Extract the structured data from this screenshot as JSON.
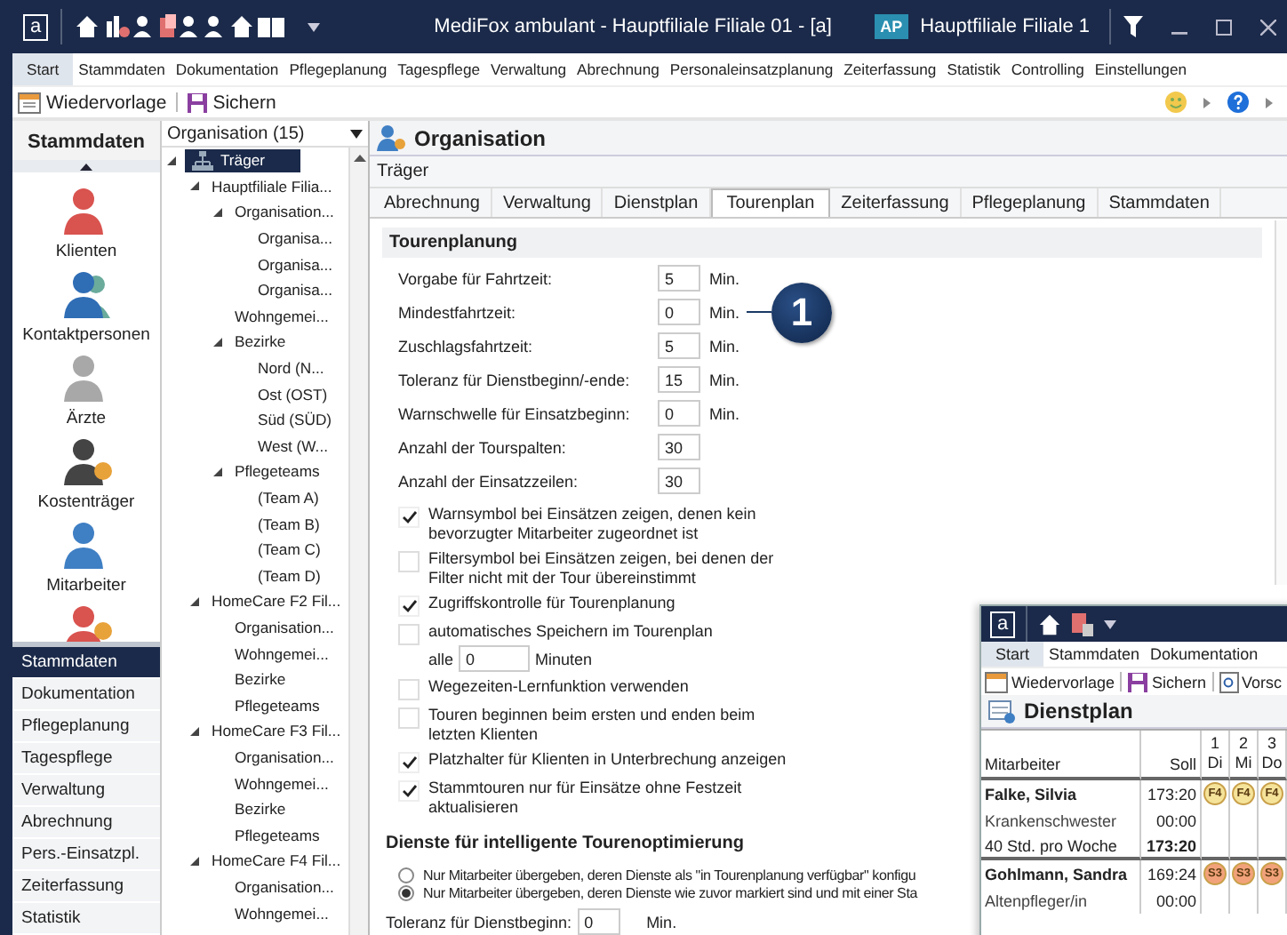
{
  "window": {
    "title": "MediFox ambulant  -  Hauptfiliale Filiale 01 - [a]",
    "app_badge": "a",
    "user_badge": "AP",
    "branch": "Hauptfiliale Filiale 1"
  },
  "menu": [
    {
      "label": "Start",
      "selected": true
    },
    {
      "label": "Stammdaten",
      "selected": false
    },
    {
      "label": "Dokumentation",
      "selected": false
    },
    {
      "label": "Pflegeplanung",
      "selected": false
    },
    {
      "label": "Tagespflege",
      "selected": false
    },
    {
      "label": "Verwaltung",
      "selected": false
    },
    {
      "label": "Abrechnung",
      "selected": false
    },
    {
      "label": "Personaleinsatzplanung",
      "selected": false
    },
    {
      "label": "Zeiterfassung",
      "selected": false
    },
    {
      "label": "Statistik",
      "selected": false
    },
    {
      "label": "Controlling",
      "selected": false
    },
    {
      "label": "Einstellungen",
      "selected": false
    }
  ],
  "toolbar": [
    "Wiedervorlage",
    "Sichern"
  ],
  "nav": {
    "title": "Stammdaten",
    "icons": [
      {
        "label": "Klienten",
        "color": "#d9534f",
        "kind": "person"
      },
      {
        "label": "Kontaktpersonen",
        "color": "#2f6db5",
        "kind": "group"
      },
      {
        "label": "Ärzte",
        "color": "#a8a8a8",
        "kind": "person"
      },
      {
        "label": "Kostenträger",
        "color": "#444444",
        "kind": "payer"
      },
      {
        "label": "Mitarbeiter",
        "color": "#3f7fc4",
        "kind": "person"
      },
      {
        "color": "#d9534f",
        "kind": "question"
      }
    ],
    "items": [
      {
        "label": "Stammdaten",
        "selected": true
      },
      {
        "label": "Dokumentation",
        "selected": false
      },
      {
        "label": "Pflegeplanung",
        "selected": false
      },
      {
        "label": "Tagespflege",
        "selected": false
      },
      {
        "label": "Verwaltung",
        "selected": false
      },
      {
        "label": "Abrechnung",
        "selected": false
      },
      {
        "label": "Pers.-Einsatzpl.",
        "selected": false
      },
      {
        "label": "Zeiterfassung",
        "selected": false
      },
      {
        "label": "Statistik",
        "selected": false
      }
    ]
  },
  "tree": {
    "header": "Organisation (15)",
    "items": [
      {
        "label": "Träger",
        "selected": true,
        "children": [
          {
            "label": "Hauptfiliale Filia...",
            "selected": false,
            "children": [
              {
                "label": "Organisation...",
                "selected": false,
                "children": [
                  {
                    "label": "Organisa...",
                    "selected": false
                  },
                  {
                    "label": "Organisa...",
                    "selected": false
                  },
                  {
                    "label": "Organisa...",
                    "selected": false
                  }
                ]
              },
              {
                "label": "Wohngemei...",
                "selected": false
              },
              {
                "label": "Bezirke",
                "selected": false,
                "children": [
                  {
                    "label": "Nord (N...",
                    "selected": false
                  },
                  {
                    "label": "Ost (OST)",
                    "selected": false
                  },
                  {
                    "label": "Süd (SÜD)",
                    "selected": false
                  },
                  {
                    "label": "West (W...",
                    "selected": false
                  }
                ]
              },
              {
                "label": "Pflegeteams",
                "selected": false,
                "children": [
                  {
                    "label": "(Team A)",
                    "selected": false
                  },
                  {
                    "label": "(Team B)",
                    "selected": false
                  },
                  {
                    "label": "(Team C)",
                    "selected": false
                  },
                  {
                    "label": "(Team D)",
                    "selected": false
                  }
                ]
              }
            ]
          },
          {
            "label": "HomeCare F2 Fil...",
            "selected": false,
            "children": [
              {
                "label": "Organisation...",
                "selected": false
              },
              {
                "label": "Wohngemei...",
                "selected": false
              },
              {
                "label": "Bezirke",
                "selected": false
              },
              {
                "label": "Pflegeteams",
                "selected": false
              }
            ]
          },
          {
            "label": "HomeCare F3 Fil...",
            "selected": false,
            "children": [
              {
                "label": "Organisation...",
                "selected": false
              },
              {
                "label": "Wohngemei...",
                "selected": false
              },
              {
                "label": "Bezirke",
                "selected": false
              },
              {
                "label": "Pflegeteams",
                "selected": false
              }
            ]
          },
          {
            "label": "HomeCare F4 Fil...",
            "selected": false,
            "children": [
              {
                "label": "Organisation...",
                "selected": false
              },
              {
                "label": "Wohngemei...",
                "selected": false
              }
            ]
          }
        ]
      }
    ]
  },
  "panel": {
    "title": "Organisation",
    "breadcrumb": "Träger",
    "tabs": [
      {
        "label": "Abrechnung",
        "selected": false
      },
      {
        "label": "Verwaltung",
        "selected": false
      },
      {
        "label": "Dienstplan",
        "selected": false
      },
      {
        "label": "Tourenplan",
        "selected": true
      },
      {
        "label": "Zeiterfassung",
        "selected": false
      },
      {
        "label": "Pflegeplanung",
        "selected": false
      },
      {
        "label": "Stammdaten",
        "selected": false
      }
    ],
    "section1": "Tourenplanung",
    "fields": [
      {
        "label": "Vorgabe für Fahrtzeit:",
        "value": "5",
        "unit": "Min."
      },
      {
        "label": "Mindestfahrtzeit:",
        "value": "0",
        "unit": "Min."
      },
      {
        "label": "Zuschlagsfahrtzeit:",
        "value": "5",
        "unit": "Min."
      },
      {
        "label": "Toleranz für Dienstbeginn/-ende:",
        "value": "15",
        "unit": "Min."
      },
      {
        "label": "Warnschwelle für Einsatzbeginn:",
        "value": "0",
        "unit": "Min."
      },
      {
        "label": "Anzahl der Tourspalten:",
        "value": "30"
      },
      {
        "label": "Anzahl der Einsatzzeilen:",
        "value": "30"
      }
    ],
    "callout": "1",
    "options": [
      {
        "kind": "checkbox",
        "label": "Warnsymbol bei Einsätzen zeigen, denen kein\nbevorzugter Mitarbeiter zugeordnet ist",
        "checked": true
      },
      {
        "kind": "checkbox",
        "label": "Filtersymbol bei Einsätzen zeigen, bei denen der\nFilter nicht mit der Tour übereinstimmt",
        "checked": false
      },
      {
        "kind": "checkbox",
        "label": "Zugriffskontrolle für Tourenplanung",
        "checked": true
      },
      {
        "kind": "interval",
        "label": "automatisches Speichern im Tourenplan",
        "checked": false,
        "prefix": "alle",
        "value": "0",
        "suffix": "Minuten"
      },
      {
        "kind": "checkbox",
        "label": "Wegezeiten-Lernfunktion verwenden",
        "checked": false
      },
      {
        "kind": "checkbox",
        "label": "Touren beginnen beim ersten und enden beim\nletzten Klienten",
        "checked": false
      },
      {
        "kind": "checkbox",
        "label": "Platzhalter für Klienten in Unterbrechung anzeigen",
        "checked": true
      },
      {
        "kind": "checkbox",
        "label": "Stammtouren nur für Einsätze ohne Festzeit\naktualisieren",
        "checked": true
      }
    ],
    "section2": "Dienste für intelligente Tourenoptimierung",
    "radios": [
      {
        "label": "Nur Mitarbeiter übergeben, deren Dienste als \"in Tourenplanung verfügbar\" konfigu",
        "selected": false
      },
      {
        "label": "Nur Mitarbeiter übergeben, deren Dienste wie zuvor markiert sind und mit einer Sta",
        "selected": true
      }
    ],
    "tolerance": {
      "label": "Toleranz für Dienstbeginn:",
      "value": "0",
      "unit": "Min."
    }
  },
  "second_window": {
    "app_badge": "a",
    "menu": [
      {
        "label": "Start",
        "selected": true
      },
      {
        "label": "Stammdaten",
        "selected": false
      },
      {
        "label": "Dokumentation",
        "selected": false
      }
    ],
    "toolbar": [
      "Wiedervorlage",
      "Sichern",
      "Vorsc"
    ],
    "title": "Dienstplan",
    "columns": [
      "Mitarbeiter",
      "Soll"
    ],
    "days": [
      {
        "day": "1",
        "weekday": "Di"
      },
      {
        "day": "2",
        "weekday": "Mi"
      },
      {
        "day": "3",
        "weekday": "Do"
      }
    ],
    "rows": [
      {
        "kind": "employee",
        "name": "Falke, Silvia",
        "soll": "173:20",
        "shifts": [
          {
            "code": "F4",
            "color": "#f5e39a"
          },
          {
            "code": "F4",
            "color": "#f5e39a"
          },
          {
            "code": "F4",
            "color": "#f5e39a"
          }
        ]
      },
      {
        "kind": "detail",
        "name": "Krankenschwester",
        "soll": "00:00"
      },
      {
        "kind": "total",
        "name": "40 Std. pro Woche",
        "soll": "173:20"
      },
      {
        "kind": "employee",
        "name": "Gohlmann, Sandra",
        "soll": "169:24",
        "shifts": [
          {
            "code": "S3",
            "color": "#f2a27a"
          },
          {
            "code": "S3",
            "color": "#f2a27a"
          },
          {
            "code": "S3",
            "color": "#f2a27a"
          }
        ]
      },
      {
        "kind": "detail",
        "name": "Altenpfleger/in",
        "soll": "00:00"
      }
    ]
  }
}
